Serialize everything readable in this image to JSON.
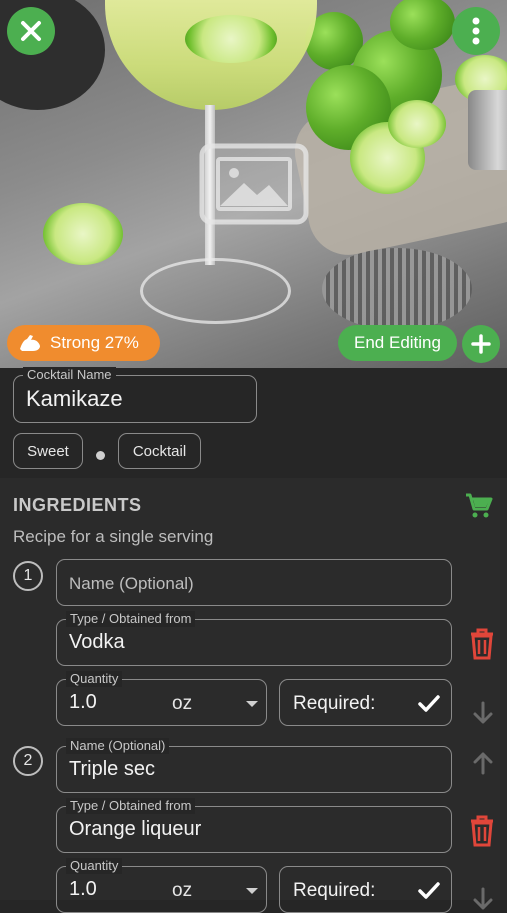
{
  "header": {
    "close_icon": "close-icon",
    "more_icon": "more-vertical-icon",
    "image_placeholder_icon": "image-placeholder-icon",
    "strength_badge": {
      "icon": "strength-arm-icon",
      "label": "Strong 27%",
      "color": "#f08c2e"
    },
    "end_editing_label": "End Editing",
    "add_icon": "plus-icon",
    "accent_color": "#4caf50"
  },
  "cocktail": {
    "name_label": "Cocktail Name",
    "name_value": "Kamikaze",
    "tags": [
      "Sweet",
      "Cocktail"
    ]
  },
  "ingredients": {
    "title": "INGREDIENTS",
    "subtitle": "Recipe for a single serving",
    "cart_icon": "shopping-cart-icon",
    "items": [
      {
        "number": "1",
        "name_placeholder": "Name (Optional)",
        "name_value": "",
        "type_label": "Type / Obtained from",
        "type_value": "Vodka",
        "quantity_label": "Quantity",
        "quantity_value": "1.0",
        "unit": "oz",
        "required_label": "Required:",
        "required": true
      },
      {
        "number": "2",
        "name_label": "Name (Optional)",
        "name_value": "Triple sec",
        "type_label": "Type / Obtained from",
        "type_value": "Orange liqueur",
        "quantity_label": "Quantity",
        "quantity_value": "1.0",
        "unit": "oz",
        "required_label": "Required:",
        "required": true
      }
    ],
    "delete_color": "#e0463a"
  }
}
